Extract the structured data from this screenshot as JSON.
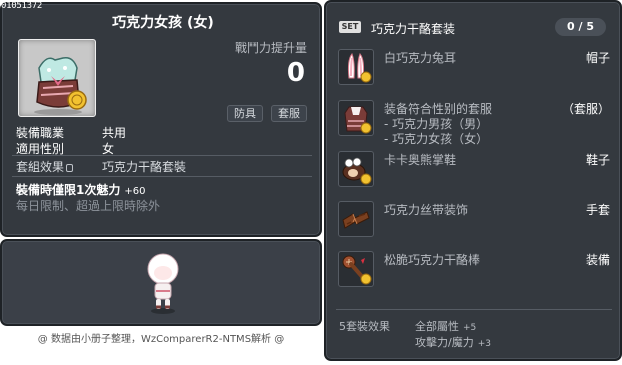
{
  "corner_id": "01051372",
  "item": {
    "title": "巧克力女孩 (女)",
    "power_label": "戰鬥力提升量",
    "power_value": "0",
    "tags": [
      "防具",
      "套服"
    ],
    "job_label": "裝備職業",
    "job_value": "共用",
    "gender_label": "適用性別",
    "gender_value": "女",
    "set_label": "套組效果",
    "set_value": "巧克力干酪套裝",
    "equip_limit": "裝備時僅限1次魅力",
    "equip_bonus": "+60",
    "limit_text": "每日限制、超過上限時除外"
  },
  "footer_note": "@ 数据由小册子整理，WzComparerR2-NTMS解析 @",
  "set": {
    "badge": "SET",
    "name": "巧克力干酪套装",
    "count": "0 / 5",
    "items": [
      {
        "name": "白巧克力兔耳",
        "slot": "帽子",
        "icon": "bunny-ears-icon"
      },
      {
        "name": "装备符合性别的套服",
        "slot": "（套服）",
        "icon": "outfit-icon",
        "subs": [
          "- 巧克力男孩（男）",
          "- 巧克力女孩（女）"
        ]
      },
      {
        "name": "卡卡奥熊掌鞋",
        "slot": "鞋子",
        "icon": "bear-paw-shoes-icon"
      },
      {
        "name": "巧克力丝带装饰",
        "slot": "手套",
        "icon": "ribbon-gloves-icon"
      },
      {
        "name": "松脆巧克力干酪棒",
        "slot": "装備",
        "icon": "cheese-stick-icon"
      }
    ],
    "effect_label": "5套裝效果",
    "effect_1_stat": "全部屬性",
    "effect_1_value": "+5",
    "effect_2_stat": "攻擊力/魔力",
    "effect_2_value": "+3"
  }
}
